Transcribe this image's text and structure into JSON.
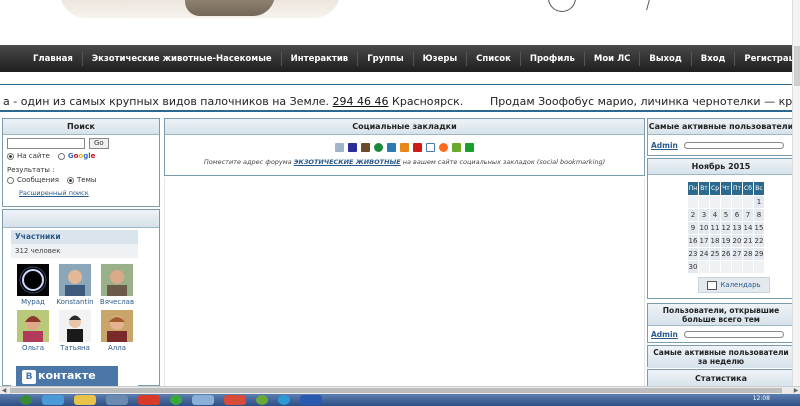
{
  "nav": {
    "items": [
      "Главная",
      "Экзотические животные-Насекомые",
      "Интерактив",
      "Группы",
      "Юзеры",
      "Список",
      "Профиль",
      "Мои ЛС",
      "Выход",
      "Вход",
      "Регистрация"
    ]
  },
  "marquee": {
    "text1": "а - один из самых крупных видов палочников на Земле. ",
    "phone": "294 46 46",
    "city": " Красноярск.",
    "text2": "Продам Зоофобус марио, личинка чернотелки — крупно"
  },
  "search": {
    "title": "Поиск",
    "go": "Go",
    "on_site": "На сайте",
    "google": [
      "G",
      "o",
      "o",
      "g",
      "l",
      "e"
    ],
    "results_label": "Результаты :",
    "messages": "Сообщения",
    "topics": "Темы",
    "advanced": "Расширенный поиск"
  },
  "members": {
    "title": "Участники",
    "count": "312 человек",
    "list": [
      {
        "name": "Мурад"
      },
      {
        "name": "Konstantin"
      },
      {
        "name": "Вячеслав"
      },
      {
        "name": "Ольга"
      },
      {
        "name": "Татьяна"
      },
      {
        "name": "Алла"
      }
    ],
    "vk_icon": "B",
    "vk_text": "контакте"
  },
  "bookmarks": {
    "title": "Социальные закладки",
    "note_before": "Поместите адрес форума ",
    "forum_link": "ЭКЗОТИЧЕСКИЕ ЖИВОТНЫЕ",
    "note_after": " на вашем сайте социальных закладок (social bookmarking)"
  },
  "sidebar": {
    "active_title": "Самые активные пользователи",
    "admin": "Admin",
    "calendar_title": "Ноябрь 2015",
    "weekdays": [
      "Пн",
      "Вт",
      "Ср",
      "Чт",
      "Пт",
      "Сб",
      "Вс"
    ],
    "weeks": [
      [
        "",
        "",
        "",
        "",
        "",
        "",
        "1"
      ],
      [
        "2",
        "3",
        "4",
        "5",
        "6",
        "7",
        "8"
      ],
      [
        "9",
        "10",
        "11",
        "12",
        "13",
        "14",
        "15"
      ],
      [
        "16",
        "17",
        "18",
        "19",
        "20",
        "21",
        "22"
      ],
      [
        "23",
        "24",
        "25",
        "26",
        "27",
        "28",
        "29"
      ],
      [
        "30",
        "",
        "",
        "",
        "",
        "",
        ""
      ]
    ],
    "calendar_button": "Календарь",
    "opened_title": "Пользователи, открывшие больше всего тем",
    "week_title": "Самые активные пользователи за неделю",
    "stats_title": "Статистика"
  },
  "taskbar": {
    "clock": "12:08"
  }
}
